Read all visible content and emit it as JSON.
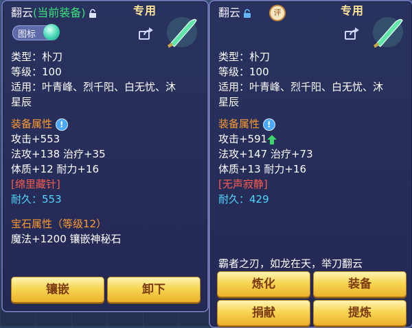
{
  "left": {
    "title_name": "翻云",
    "title_status": "(当前装备)",
    "tag": "专用",
    "icon_label": "图标",
    "lines": {
      "type": "类型：朴刀",
      "level": "等级：100",
      "suitable_1": "适用：叶青峰、烈千阳、白无忧、沐",
      "suitable_2": "星辰",
      "equip_attr": "装备属性",
      "attack": "攻击+553",
      "magic_heal": "法攻+138 治疗+35",
      "physique": "体质+12 耐力+16",
      "special": "[绵里藏针]",
      "durability": "耐久：553",
      "gem_attr": "宝石属性（等级12）",
      "gem_value": "魔法+1200 镶嵌神秘石"
    },
    "buttons": {
      "inlay": "镶嵌",
      "unequip": "卸下"
    }
  },
  "right": {
    "title_name": "翻云",
    "badge": "评",
    "tag": "专用",
    "lines": {
      "type": "类型：朴刀",
      "level": "等级：100",
      "suitable_1": "适用：叶青峰、烈千阳、白无忧、沐",
      "suitable_2": "星辰",
      "equip_attr": "装备属性",
      "attack": "攻击+591",
      "magic_heal": "法攻+147 治疗+73",
      "physique": "体质+13 耐力+16",
      "special": "[无声寂静]",
      "durability": "耐久：429"
    },
    "quote": "霸者之刃，如龙在天，举刀翻云",
    "buttons": {
      "refine": "炼化",
      "equip": "装备",
      "donate": "捐献",
      "extract": "提炼"
    }
  },
  "colors": {
    "equipped": "#39e27a",
    "section": "#ff9a2e",
    "special": "#ff5a4e",
    "durability": "#4fd7ff",
    "button": "#f7d654"
  },
  "icons": [
    "lock-icon",
    "share-icon",
    "weapon-icon",
    "info-icon",
    "up-arrow-icon",
    "icon-orb"
  ]
}
